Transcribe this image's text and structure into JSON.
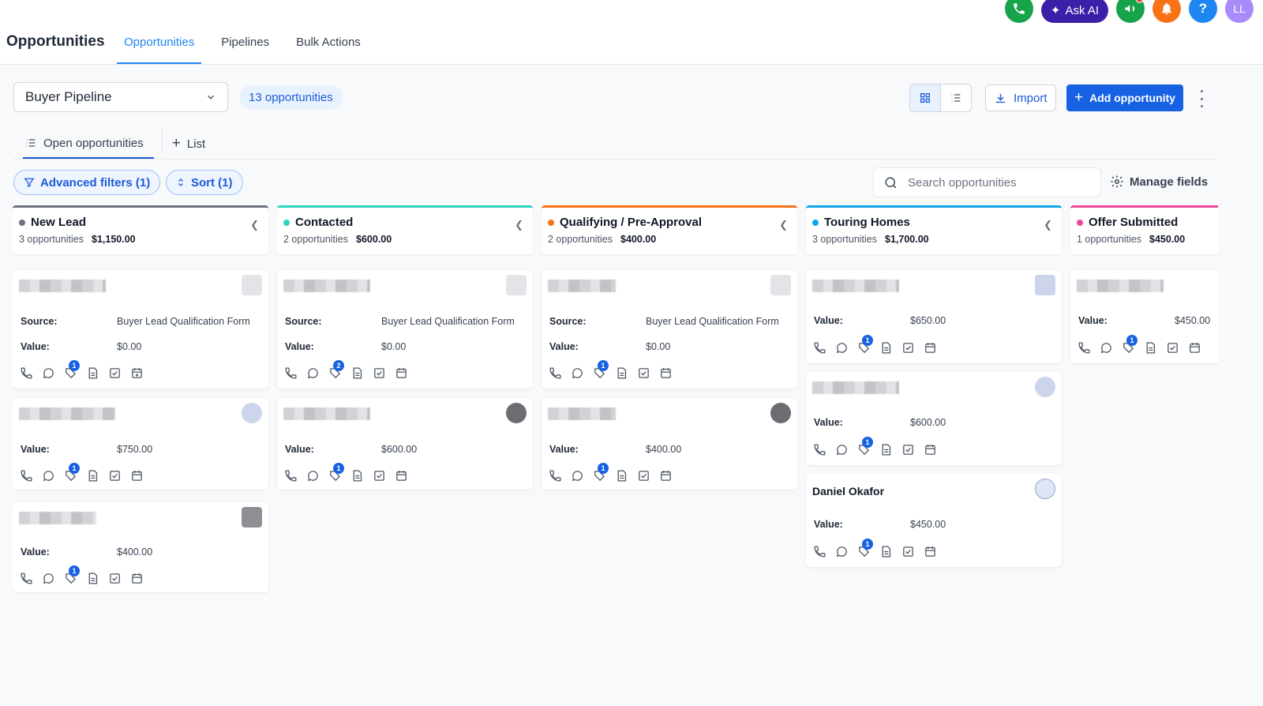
{
  "header": {
    "title": "Opportunities",
    "tabs": [
      {
        "label": "Opportunities",
        "active": true
      },
      {
        "label": "Pipelines",
        "active": false
      },
      {
        "label": "Bulk Actions",
        "active": false
      }
    ],
    "ask_ai_label": "Ask AI",
    "help_label": "?",
    "avatar_initials": "LL",
    "colors": {
      "phone": "#16a34a",
      "ask_ai": "#3b1fa8",
      "announce": "#16a34a",
      "bell": "#f97316",
      "help": "#1d86f0",
      "avatar": "#a78bfa"
    }
  },
  "toolbar": {
    "pipeline": "Buyer Pipeline",
    "opportunities_badge": "13 opportunities",
    "import_label": "Import",
    "add_label": "Add opportunity"
  },
  "list_tabs": {
    "open": "Open opportunities",
    "add_list": "List"
  },
  "filters": {
    "advanced": "Advanced filters (1)",
    "sort": "Sort (1)",
    "search_placeholder": "Search opportunities",
    "manage_fields": "Manage fields"
  },
  "card_labels": {
    "source": "Source:",
    "value": "Value:"
  },
  "columns": [
    {
      "name": "New Lead",
      "color": "#6b7280",
      "count": "3 opportunities",
      "total": "$1,150.00",
      "cards": [
        {
          "source": "Buyer Lead Qualification Form",
          "value": "$0.00",
          "badge": "1"
        },
        {
          "value": "$750.00",
          "badge": "1"
        },
        {
          "value": "$400.00",
          "badge": "1"
        }
      ]
    },
    {
      "name": "Contacted",
      "color": "#2dd4bf",
      "count": "2 opportunities",
      "total": "$600.00",
      "cards": [
        {
          "source": "Buyer Lead Qualification Form",
          "value": "$0.00",
          "badge": "2"
        },
        {
          "value": "$600.00",
          "badge": "1"
        }
      ]
    },
    {
      "name": "Qualifying / Pre-Approval",
      "color": "#f97316",
      "count": "2 opportunities",
      "total": "$400.00",
      "cards": [
        {
          "source": "Buyer Lead Qualification Form",
          "value": "$0.00",
          "badge": "1"
        },
        {
          "value": "$400.00",
          "badge": "1"
        }
      ]
    },
    {
      "name": "Touring Homes",
      "color": "#0ea5e9",
      "count": "3 opportunities",
      "total": "$1,700.00",
      "cards": [
        {
          "value": "$650.00",
          "badge": "1"
        },
        {
          "value": "$600.00",
          "badge": "1"
        },
        {
          "name": "Daniel Okafor",
          "value": "$450.00",
          "badge": "1"
        }
      ]
    },
    {
      "name": "Offer Submitted",
      "color": "#ec4899",
      "count": "1 opportunities",
      "total": "$450.00",
      "cards": [
        {
          "value": "$450.00",
          "badge": "1"
        }
      ]
    }
  ]
}
